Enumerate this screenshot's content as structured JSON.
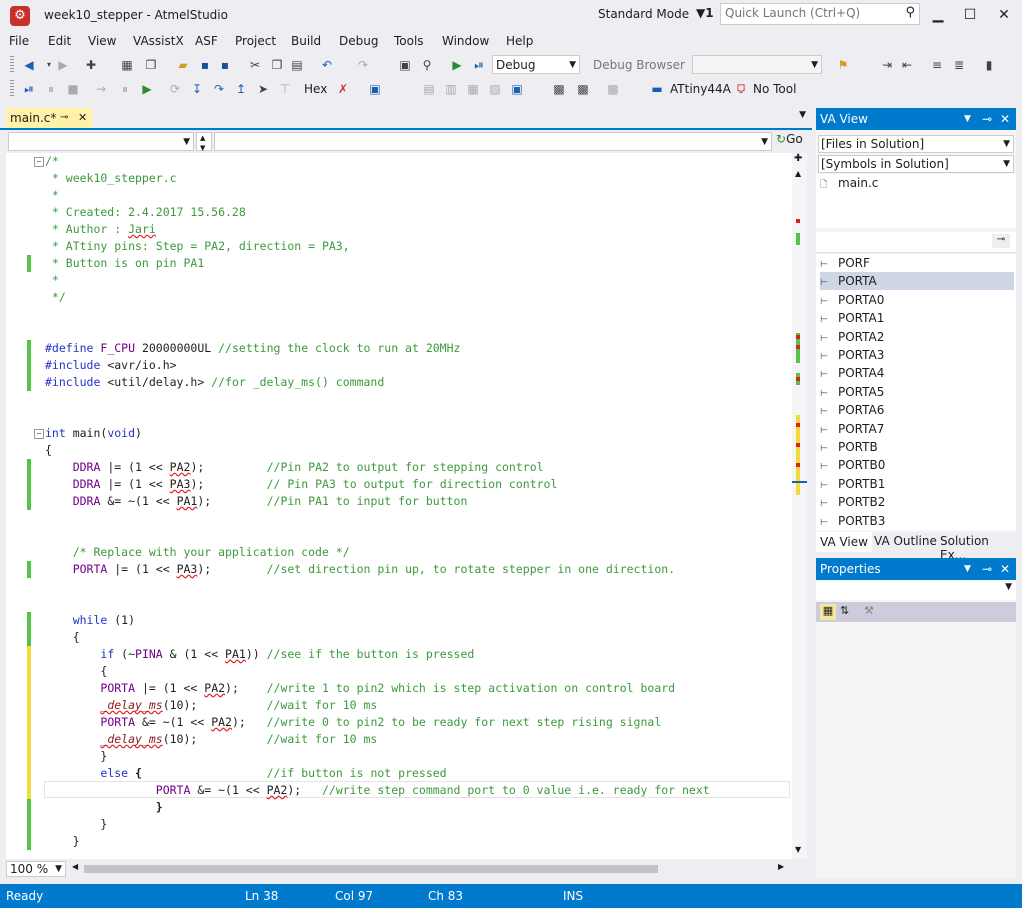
{
  "window": {
    "title": "week10_stepper - AtmelStudio",
    "mode": "Standard Mode",
    "notification_count": "1",
    "quick_launch_placeholder": "Quick Launch (Ctrl+Q)"
  },
  "menu": [
    "File",
    "Edit",
    "View",
    "VAssistX",
    "ASF",
    "Project",
    "Build",
    "Debug",
    "Tools",
    "Window",
    "Help"
  ],
  "toolbar": {
    "config": "Debug",
    "debug_browser": "Debug Browser",
    "hex": "Hex",
    "device": "ATtiny44A",
    "tool": "No Tool"
  },
  "editor": {
    "tab_label": "main.c*",
    "go_label": "Go",
    "zoom": "100 %",
    "lines": [
      {
        "t": "/*",
        "c": "cm"
      },
      {
        "t": " * week10_stepper.c",
        "c": "cm"
      },
      {
        "t": " *",
        "c": "cm"
      },
      {
        "t": " * Created: 2.4.2017 15.56.28",
        "c": "cm"
      },
      {
        "t": " * Author : Jari",
        "c": "cm"
      },
      {
        "t": " * ATtiny pins: Step = PA2, direction = PA3,",
        "c": "cm"
      },
      {
        "t": " * Button is on pin PA1",
        "c": "cm"
      },
      {
        "t": " *",
        "c": "cm"
      },
      {
        "t": " */",
        "c": "cm"
      },
      {
        "t": "",
        "c": ""
      },
      {
        "t": "",
        "c": ""
      },
      {
        "t": "#define F_CPU 20000000UL //setting the clock to run at 20MHz",
        "c": "def"
      },
      {
        "t": "#include <avr/io.h>",
        "c": "inc"
      },
      {
        "t": "#include <util/delay.h> //for _delay_ms() command",
        "c": "inc2"
      },
      {
        "t": "",
        "c": ""
      },
      {
        "t": "",
        "c": ""
      },
      {
        "t": "int main(void)",
        "c": "main"
      },
      {
        "t": "{",
        "c": ""
      },
      {
        "t": "    DDRA |= (1 << PA2);         //Pin PA2 to output for stepping control",
        "c": "d1"
      },
      {
        "t": "    DDRA |= (1 << PA3);         // Pin PA3 to output for direction control",
        "c": "d2"
      },
      {
        "t": "    DDRA &= ~(1 << PA1);        //Pin PA1 to input for button",
        "c": "d3"
      },
      {
        "t": "",
        "c": ""
      },
      {
        "t": "",
        "c": ""
      },
      {
        "t": "    /* Replace with your application code */",
        "c": "cm"
      },
      {
        "t": "    PORTA |= (1 << PA3);        //set direction pin up, to rotate stepper in one direction.",
        "c": "p1"
      },
      {
        "t": "",
        "c": ""
      },
      {
        "t": "",
        "c": ""
      },
      {
        "t": "    while (1)",
        "c": "while"
      },
      {
        "t": "    {",
        "c": ""
      },
      {
        "t": "        if (~PINA & (1 << PA1)) //see if the button is pressed",
        "c": "if"
      },
      {
        "t": "        {",
        "c": ""
      },
      {
        "t": "        PORTA |= (1 << PA2);    //write 1 to pin2 which is step activation on control board",
        "c": "p2"
      },
      {
        "t": "        _delay_ms(10);          //wait for 10 ms",
        "c": "dl1"
      },
      {
        "t": "        PORTA &= ~(1 << PA2);   //write 0 to pin2 to be ready for next step rising signal",
        "c": "p3"
      },
      {
        "t": "        _delay_ms(10);          //wait for 10 ms",
        "c": "dl2"
      },
      {
        "t": "        }",
        "c": ""
      },
      {
        "t": "        else {                  //if button is not pressed",
        "c": "else"
      },
      {
        "t": "                PORTA &= ~(1 << PA2);   //write step command port to 0 value i.e. ready for next",
        "c": "p4"
      },
      {
        "t": "                }",
        "c": "bold"
      },
      {
        "t": "        }",
        "c": ""
      },
      {
        "t": "    }",
        "c": ""
      }
    ]
  },
  "va_view": {
    "title": "VA View",
    "files_combo": "[Files in Solution]",
    "symbols_combo": "[Symbols in Solution]",
    "file": "main.c",
    "symbols": [
      "PORF",
      "PORTA",
      "PORTA0",
      "PORTA1",
      "PORTA2",
      "PORTA3",
      "PORTA4",
      "PORTA5",
      "PORTA6",
      "PORTA7",
      "PORTB",
      "PORTB0",
      "PORTB1",
      "PORTB2",
      "PORTB3"
    ],
    "tabs": [
      "VA View",
      "VA Outline",
      "Solution Ex..."
    ]
  },
  "properties": {
    "title": "Properties"
  },
  "status": {
    "ready": "Ready",
    "ln": "Ln 38",
    "col": "Col 97",
    "ch": "Ch 83",
    "ins": "INS"
  },
  "colors": {
    "accent": "#007acc",
    "comment": "#3c9a3c",
    "keyword": "#2233cc",
    "macro": "#6f008a"
  }
}
